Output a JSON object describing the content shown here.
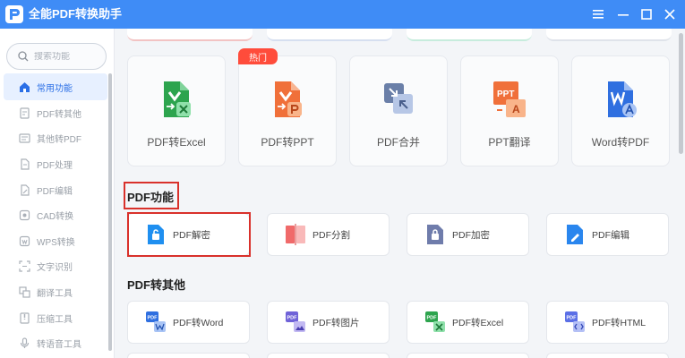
{
  "app": {
    "title": "全能PDF转换助手"
  },
  "colors": {
    "titlebar": "#3f8cf6",
    "accent": "#2b6fe6",
    "highlight": "#d9312b",
    "hot": "#ff4c3b"
  },
  "sidebar": {
    "search_placeholder": "搜索功能",
    "items": [
      {
        "label": "常用功能",
        "icon": "home-icon",
        "active": true
      },
      {
        "label": "PDF转其他",
        "icon": "pdf-to-other-icon"
      },
      {
        "label": "其他转PDF",
        "icon": "other-to-pdf-icon"
      },
      {
        "label": "PDF处理",
        "icon": "pdf-process-icon"
      },
      {
        "label": "PDF编辑",
        "icon": "pdf-edit-icon"
      },
      {
        "label": "CAD转换",
        "icon": "cad-icon"
      },
      {
        "label": "WPS转换",
        "icon": "wps-icon"
      },
      {
        "label": "文字识别",
        "icon": "ocr-icon"
      },
      {
        "label": "翻译工具",
        "icon": "translate-icon"
      },
      {
        "label": "压缩工具",
        "icon": "compress-icon"
      },
      {
        "label": "转语音工具",
        "icon": "voice-icon"
      }
    ]
  },
  "featured": {
    "hot_badge": "热门",
    "cards": [
      {
        "label": "PDF转Excel",
        "icon": "pdf-to-excel-icon"
      },
      {
        "label": "PDF转PPT",
        "icon": "pdf-to-ppt-icon"
      },
      {
        "label": "PDF合并",
        "icon": "pdf-merge-icon"
      },
      {
        "label": "PPT翻译",
        "icon": "ppt-translate-icon"
      },
      {
        "label": "Word转PDF",
        "icon": "word-to-pdf-icon"
      }
    ]
  },
  "sections": [
    {
      "title": "PDF功能",
      "tools": [
        {
          "label": "PDF解密",
          "icon": "pdf-decrypt-icon"
        },
        {
          "label": "PDF分割",
          "icon": "pdf-split-icon"
        },
        {
          "label": "PDF加密",
          "icon": "pdf-encrypt-icon"
        },
        {
          "label": "PDF编辑",
          "icon": "pdf-edit-icon"
        }
      ]
    },
    {
      "title": "PDF转其他",
      "tools": [
        {
          "label": "PDF转Word",
          "icon": "pdf-to-word-icon"
        },
        {
          "label": "PDF转图片",
          "icon": "pdf-to-image-icon"
        },
        {
          "label": "PDF转Excel",
          "icon": "pdf-to-excel-icon"
        },
        {
          "label": "PDF转HTML",
          "icon": "pdf-to-html-icon"
        }
      ]
    }
  ]
}
